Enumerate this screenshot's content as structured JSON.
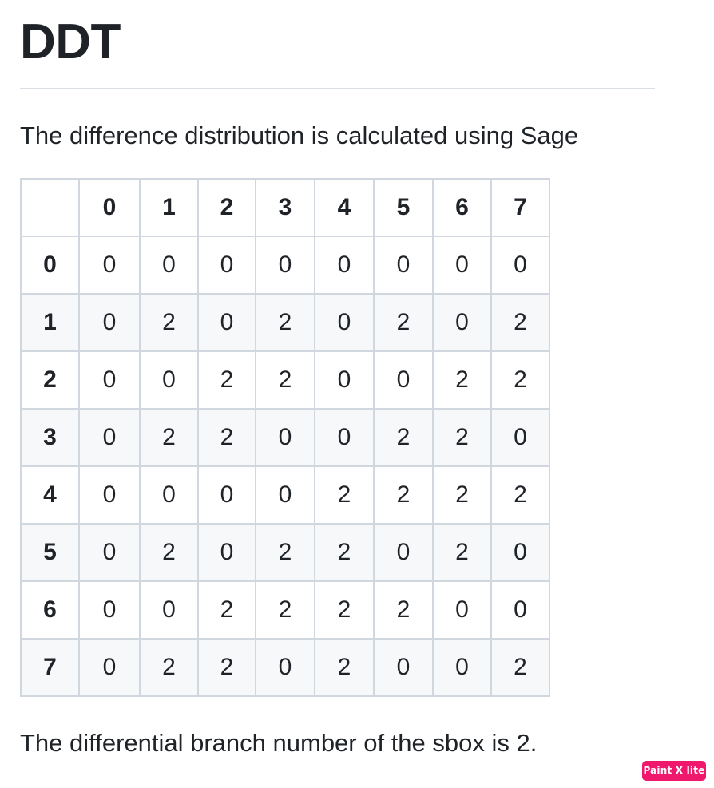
{
  "title": "DDT",
  "intro": "The difference distribution is calculated using Sage",
  "table": {
    "corner": "",
    "columns": [
      "0",
      "1",
      "2",
      "3",
      "4",
      "5",
      "6",
      "7"
    ],
    "rows": [
      {
        "label": "0",
        "cells": [
          "0",
          "0",
          "0",
          "0",
          "0",
          "0",
          "0",
          "0"
        ]
      },
      {
        "label": "1",
        "cells": [
          "0",
          "2",
          "0",
          "2",
          "0",
          "2",
          "0",
          "2"
        ]
      },
      {
        "label": "2",
        "cells": [
          "0",
          "0",
          "2",
          "2",
          "0",
          "0",
          "2",
          "2"
        ]
      },
      {
        "label": "3",
        "cells": [
          "0",
          "2",
          "2",
          "0",
          "0",
          "2",
          "2",
          "0"
        ]
      },
      {
        "label": "4",
        "cells": [
          "0",
          "0",
          "0",
          "0",
          "2",
          "2",
          "2",
          "2"
        ]
      },
      {
        "label": "5",
        "cells": [
          "0",
          "2",
          "0",
          "2",
          "2",
          "0",
          "2",
          "0"
        ]
      },
      {
        "label": "6",
        "cells": [
          "0",
          "0",
          "2",
          "2",
          "2",
          "2",
          "0",
          "0"
        ]
      },
      {
        "label": "7",
        "cells": [
          "0",
          "2",
          "2",
          "0",
          "2",
          "0",
          "0",
          "2"
        ]
      }
    ]
  },
  "outro": "The differential branch number of the sbox is 2.",
  "badge": {
    "label": "Paint X lite",
    "color": "#f0186c"
  }
}
